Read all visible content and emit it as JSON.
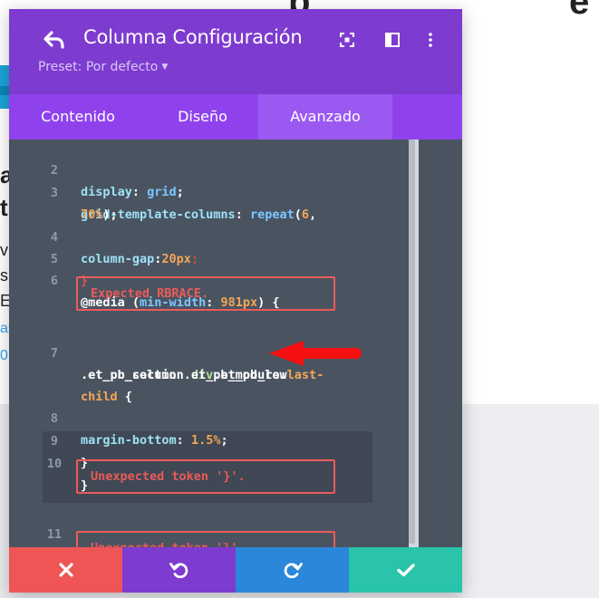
{
  "modal": {
    "title": "Columna Configuración",
    "preset_label": "Preset: Por defecto",
    "tabs": [
      {
        "label": "Contenido",
        "active": false
      },
      {
        "label": "Diseño",
        "active": false
      },
      {
        "label": "Avanzado",
        "active": true
      }
    ],
    "header_icons": [
      "back-arrow-icon",
      "expand-icon",
      "split-view-icon",
      "more-options-icon"
    ]
  },
  "editor": {
    "lines": [
      {
        "num": "2",
        "text": "display: grid;"
      },
      {
        "num": "3",
        "text": "grid-template-columns: repeat(6,"
      },
      {
        "num": "",
        "text": "70%);"
      },
      {
        "num": "4",
        "text": "column-gap:20px;"
      },
      {
        "num": "5",
        "text": "}"
      },
      {
        "num": "6",
        "text": "@media (min-width: 981px) {"
      },
      {
        "num": "7",
        "text": ".et_pb_section div.et_pb_row"
      },
      {
        "num": "",
        "text": ".et_pb_column .et_pb_module:last-"
      },
      {
        "num": "",
        "text": "child {"
      },
      {
        "num": "8",
        "text": "margin-bottom: 1.5%;"
      },
      {
        "num": "9",
        "text": "}"
      },
      {
        "num": "10",
        "text": "}"
      },
      {
        "num": "11",
        "text": ""
      }
    ],
    "errors": [
      "Expected RBRACE.",
      "Unexpected token '}'.",
      "Unexpected token '}'."
    ]
  },
  "footer": {
    "buttons": [
      {
        "icon": "close-icon",
        "color": "#ef5555"
      },
      {
        "icon": "undo-icon",
        "color": "#7e3bd0"
      },
      {
        "icon": "redo-icon",
        "color": "#2b87da"
      },
      {
        "icon": "check-icon",
        "color": "#29c4a9"
      }
    ]
  },
  "background": {
    "fragments": [
      "a",
      "ti",
      "v",
      "si",
      "E",
      "as",
      "0"
    ]
  },
  "colors": {
    "header": "#7e3bd0",
    "tabs": "#8f42ec",
    "active_tab": "#9b59f2",
    "editor_bg": "#4a5461",
    "error": "#ec5a5a"
  }
}
